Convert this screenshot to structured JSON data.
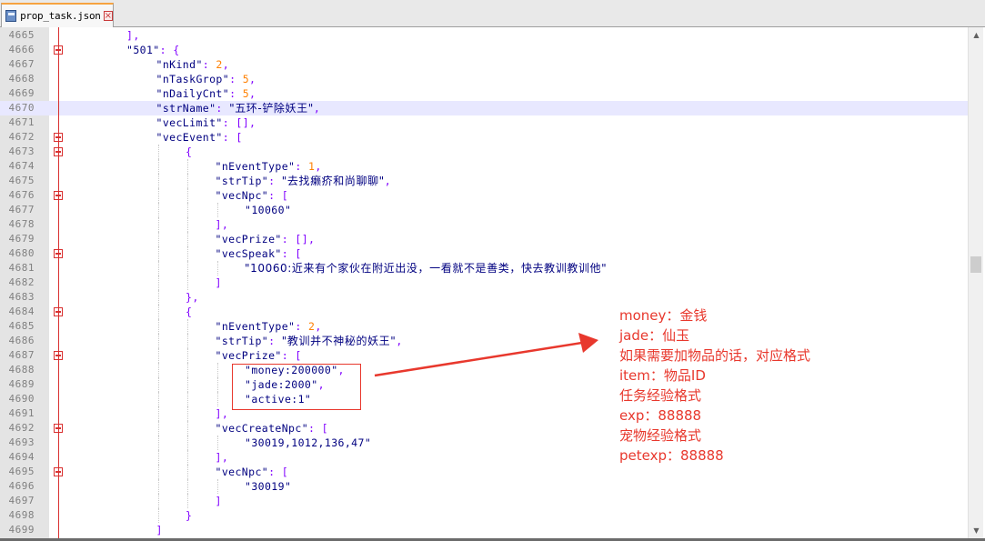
{
  "tab": {
    "filename": "prop_task.json",
    "close_glyph": "×",
    "file_icon": "save-icon"
  },
  "lines": [
    {
      "num": "4665",
      "indent": 2,
      "tokens": [
        [
          "pun",
          "],"
        ]
      ]
    },
    {
      "num": "4666",
      "indent": 2,
      "fold": "open",
      "tokens": [
        [
          "str",
          "\"501\""
        ],
        [
          "pun",
          ": {"
        ]
      ]
    },
    {
      "num": "4667",
      "indent": 3,
      "tokens": [
        [
          "key",
          "\"nKind\""
        ],
        [
          "pun",
          ": "
        ],
        [
          "num",
          "2"
        ],
        [
          "pun",
          ","
        ]
      ]
    },
    {
      "num": "4668",
      "indent": 3,
      "tokens": [
        [
          "key",
          "\"nTaskGrop\""
        ],
        [
          "pun",
          ": "
        ],
        [
          "num",
          "5"
        ],
        [
          "pun",
          ","
        ]
      ]
    },
    {
      "num": "4669",
      "indent": 3,
      "tokens": [
        [
          "key",
          "\"nDailyCnt\""
        ],
        [
          "pun",
          ": "
        ],
        [
          "num",
          "5"
        ],
        [
          "pun",
          ","
        ]
      ]
    },
    {
      "num": "4670",
      "indent": 3,
      "current": true,
      "tokens": [
        [
          "key",
          "\"strName\""
        ],
        [
          "pun",
          ": "
        ],
        [
          "str",
          "\"五环-铲除妖王\""
        ],
        [
          "pun",
          ","
        ]
      ]
    },
    {
      "num": "4671",
      "indent": 3,
      "tokens": [
        [
          "key",
          "\"vecLimit\""
        ],
        [
          "pun",
          ": [],"
        ]
      ]
    },
    {
      "num": "4672",
      "indent": 3,
      "fold": "open",
      "tokens": [
        [
          "key",
          "\"vecEvent\""
        ],
        [
          "pun",
          ": ["
        ]
      ]
    },
    {
      "num": "4673",
      "indent": 4,
      "fold": "open",
      "tokens": [
        [
          "pun",
          "{"
        ]
      ]
    },
    {
      "num": "4674",
      "indent": 5,
      "tokens": [
        [
          "key",
          "\"nEventType\""
        ],
        [
          "pun",
          ": "
        ],
        [
          "num",
          "1"
        ],
        [
          "pun",
          ","
        ]
      ]
    },
    {
      "num": "4675",
      "indent": 5,
      "tokens": [
        [
          "key",
          "\"strTip\""
        ],
        [
          "pun",
          ": "
        ],
        [
          "str",
          "\"去找癞疥和尚聊聊\""
        ],
        [
          "pun",
          ","
        ]
      ]
    },
    {
      "num": "4676",
      "indent": 5,
      "fold": "open",
      "tokens": [
        [
          "key",
          "\"vecNpc\""
        ],
        [
          "pun",
          ": ["
        ]
      ]
    },
    {
      "num": "4677",
      "indent": 6,
      "tokens": [
        [
          "str",
          "\"10060\""
        ]
      ]
    },
    {
      "num": "4678",
      "indent": 5,
      "tokens": [
        [
          "pun",
          "],"
        ]
      ]
    },
    {
      "num": "4679",
      "indent": 5,
      "tokens": [
        [
          "key",
          "\"vecPrize\""
        ],
        [
          "pun",
          ": [],"
        ]
      ]
    },
    {
      "num": "4680",
      "indent": 5,
      "fold": "open",
      "tokens": [
        [
          "key",
          "\"vecSpeak\""
        ],
        [
          "pun",
          ": ["
        ]
      ]
    },
    {
      "num": "4681",
      "indent": 6,
      "tokens": [
        [
          "str",
          "\"10060:近来有个家伙在附近出没，一看就不是善类，快去教训教训他\""
        ]
      ]
    },
    {
      "num": "4682",
      "indent": 5,
      "tokens": [
        [
          "pun",
          "]"
        ]
      ]
    },
    {
      "num": "4683",
      "indent": 4,
      "tokens": [
        [
          "pun",
          "},"
        ]
      ]
    },
    {
      "num": "4684",
      "indent": 4,
      "fold": "open",
      "tokens": [
        [
          "pun",
          "{"
        ]
      ]
    },
    {
      "num": "4685",
      "indent": 5,
      "tokens": [
        [
          "key",
          "\"nEventType\""
        ],
        [
          "pun",
          ": "
        ],
        [
          "num",
          "2"
        ],
        [
          "pun",
          ","
        ]
      ]
    },
    {
      "num": "4686",
      "indent": 5,
      "tokens": [
        [
          "key",
          "\"strTip\""
        ],
        [
          "pun",
          ": "
        ],
        [
          "str",
          "\"教训并不神秘的妖王\""
        ],
        [
          "pun",
          ","
        ]
      ]
    },
    {
      "num": "4687",
      "indent": 5,
      "fold": "open",
      "tokens": [
        [
          "key",
          "\"vecPrize\""
        ],
        [
          "pun",
          ": ["
        ]
      ]
    },
    {
      "num": "4688",
      "indent": 6,
      "tokens": [
        [
          "str",
          "\"money:200000\""
        ],
        [
          "pun",
          ","
        ]
      ]
    },
    {
      "num": "4689",
      "indent": 6,
      "tokens": [
        [
          "str",
          "\"jade:2000\""
        ],
        [
          "pun",
          ","
        ]
      ]
    },
    {
      "num": "4690",
      "indent": 6,
      "tokens": [
        [
          "str",
          "\"active:1\""
        ]
      ]
    },
    {
      "num": "4691",
      "indent": 5,
      "tokens": [
        [
          "pun",
          "],"
        ]
      ]
    },
    {
      "num": "4692",
      "indent": 5,
      "fold": "open",
      "tokens": [
        [
          "key",
          "\"vecCreateNpc\""
        ],
        [
          "pun",
          ": ["
        ]
      ]
    },
    {
      "num": "4693",
      "indent": 6,
      "tokens": [
        [
          "str",
          "\"30019,1012,136,47\""
        ]
      ]
    },
    {
      "num": "4694",
      "indent": 5,
      "tokens": [
        [
          "pun",
          "],"
        ]
      ]
    },
    {
      "num": "4695",
      "indent": 5,
      "fold": "open",
      "tokens": [
        [
          "key",
          "\"vecNpc\""
        ],
        [
          "pun",
          ": ["
        ]
      ]
    },
    {
      "num": "4696",
      "indent": 6,
      "tokens": [
        [
          "str",
          "\"30019\""
        ]
      ]
    },
    {
      "num": "4697",
      "indent": 5,
      "tokens": [
        [
          "pun",
          "]"
        ]
      ]
    },
    {
      "num": "4698",
      "indent": 4,
      "tokens": [
        [
          "pun",
          "}"
        ]
      ]
    },
    {
      "num": "4699",
      "indent": 3,
      "tokens": [
        [
          "pun",
          "]"
        ]
      ]
    }
  ],
  "annotation": {
    "color": "#e8382d",
    "notes": [
      "money：金钱",
      "jade：仙玉",
      "如果需要加物品的话，对应格式",
      "item：物品ID",
      "任务经验格式",
      "exp：88888",
      "宠物经验格式",
      "petexp：88888"
    ]
  },
  "scrollbar": {
    "position_fraction": 0.46,
    "up_glyph": "▲",
    "down_glyph": "▼"
  }
}
